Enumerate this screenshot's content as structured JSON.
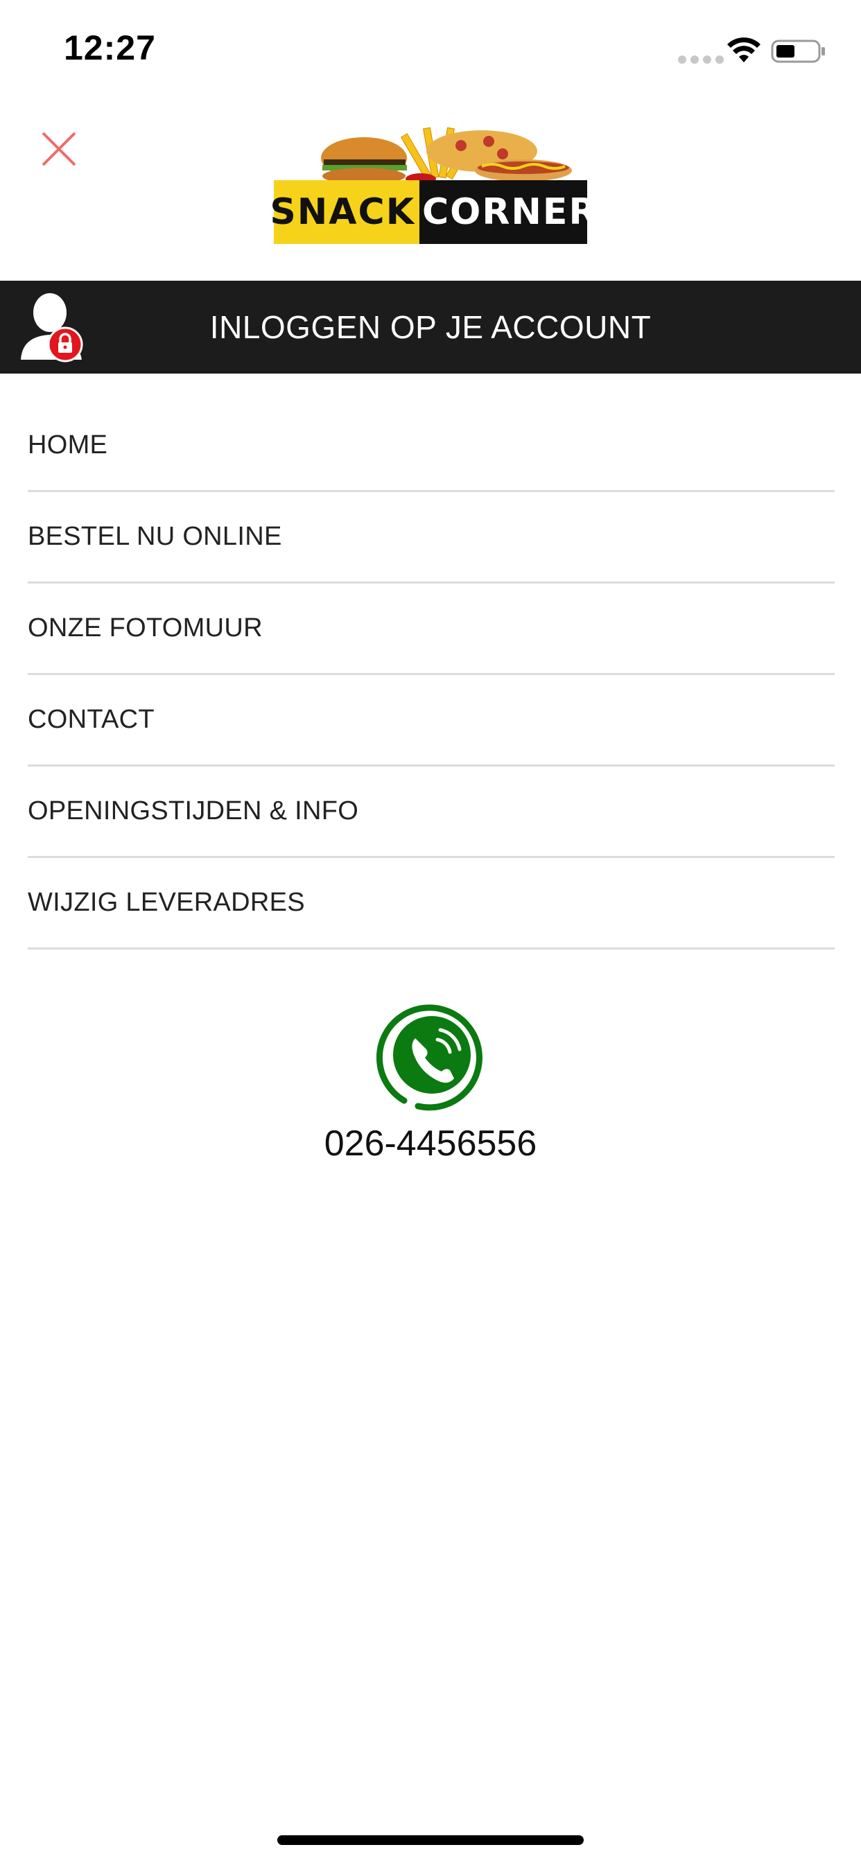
{
  "status_bar": {
    "time": "12:27"
  },
  "header": {
    "logo": {
      "part1": "SNACK",
      "part2": "CORNER"
    }
  },
  "login_bar": {
    "label": "INLOGGEN OP JE ACCOUNT"
  },
  "menu": {
    "items": [
      {
        "label": "HOME"
      },
      {
        "label": "BESTEL NU ONLINE"
      },
      {
        "label": "ONZE FOTOMUUR"
      },
      {
        "label": "CONTACT"
      },
      {
        "label": "OPENINGSTIJDEN & INFO"
      },
      {
        "label": "WIJZIG LEVERADRES"
      }
    ]
  },
  "contact": {
    "phone": "026-4456556"
  },
  "icons": {
    "close": "close-icon",
    "user_lock": "user-lock-icon",
    "phone": "phone-icon",
    "wifi": "wifi-icon",
    "battery": "battery-icon"
  },
  "colors": {
    "close": "#f06a6a",
    "login_bar_bg": "#1c1c1c",
    "lock_badge": "#e2161c",
    "phone_green": "#0b7a10",
    "logo_yellow": "#f6d21a",
    "logo_black": "#111111"
  }
}
